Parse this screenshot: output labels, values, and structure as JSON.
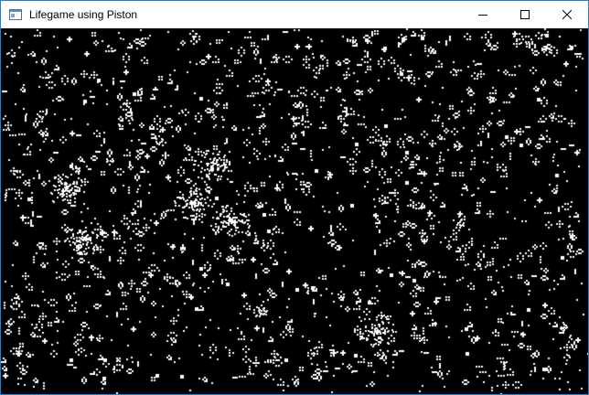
{
  "window": {
    "title": "Lifegame using Piston",
    "app_icon": "window-app-icon",
    "buttons": {
      "minimize_icon": "minimize-icon",
      "maximize_icon": "maximize-icon",
      "close_icon": "close-icon"
    }
  },
  "game": {
    "background_color": "#000000",
    "cell_color": "#ffffff",
    "state": "running"
  },
  "colors": {
    "border": "#1883d7",
    "titlebar": "#ffffff",
    "title_text": "#000000"
  }
}
